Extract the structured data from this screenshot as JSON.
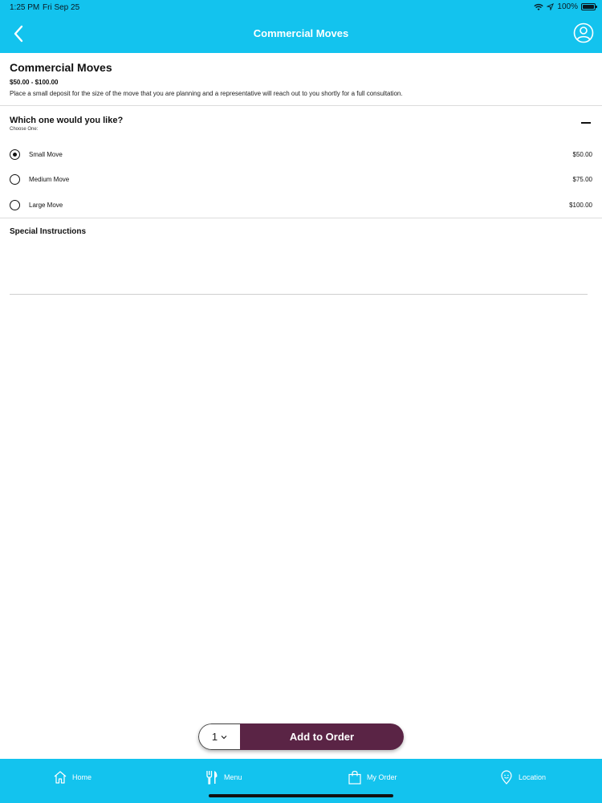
{
  "status_bar": {
    "time": "1:25 PM",
    "date": "Fri Sep 25",
    "battery": "100%"
  },
  "nav": {
    "title": "Commercial Moves"
  },
  "product": {
    "title": "Commercial Moves",
    "price_range": "$50.00 - $100.00",
    "description": "Place a small deposit for the size of the move that you are planning and a representative will reach out to you shortly for a full consultation."
  },
  "question": {
    "title": "Which one would you like?",
    "subtitle": "Choose One:",
    "options": [
      {
        "label": "Small Move",
        "price": "$50.00",
        "selected": true
      },
      {
        "label": "Medium Move",
        "price": "$75.00",
        "selected": false
      },
      {
        "label": "Large Move",
        "price": "$100.00",
        "selected": false
      }
    ]
  },
  "special_instructions": {
    "title": "Special Instructions",
    "value": "",
    "placeholder": ""
  },
  "order": {
    "quantity": "1",
    "add_label": "Add to Order"
  },
  "tabs": [
    {
      "label": "Home",
      "icon": "home-icon"
    },
    {
      "label": "Menu",
      "icon": "utensils-icon"
    },
    {
      "label": "My Order",
      "icon": "shopping-bag-icon"
    },
    {
      "label": "Location",
      "icon": "location-pin-icon"
    }
  ],
  "colors": {
    "header": "#13c3ee",
    "add_button": "#5a2445"
  }
}
